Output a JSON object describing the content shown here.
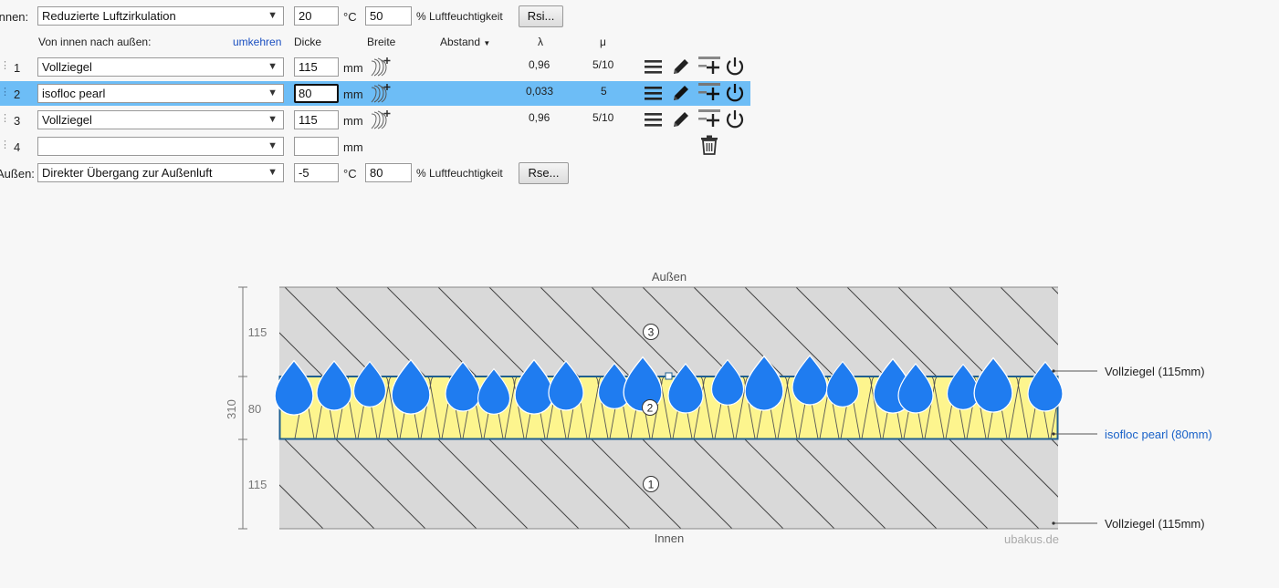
{
  "inside": {
    "label": "Innen:",
    "select_value": "Reduzierte Luftzirkulation",
    "temp": "20",
    "temp_unit": "°C",
    "humidity": "50",
    "humidity_label": "% Luftfeuchtigkeit",
    "button": "Rsi..."
  },
  "outside": {
    "label": "Außen:",
    "select_value": "Direkter Übergang zur Außenluft",
    "temp": "-5",
    "temp_unit": "°C",
    "humidity": "80",
    "humidity_label": "% Luftfeuchtigkeit",
    "button": "Rse..."
  },
  "headers": {
    "direction": "Von innen nach außen:",
    "reverse": "umkehren",
    "thickness": "Dicke",
    "width": "Breite",
    "spacing": "Abstand",
    "lambda": "λ",
    "mu": "μ"
  },
  "layers": [
    {
      "num": "1",
      "material": "Vollziegel",
      "thickness": "115",
      "unit": "mm",
      "lambda": "0,96",
      "mu": "5/10"
    },
    {
      "num": "2",
      "material": "isofloc pearl",
      "thickness": "80",
      "unit": "mm",
      "lambda": "0,033",
      "mu": "5",
      "selected": true
    },
    {
      "num": "3",
      "material": "Vollziegel",
      "thickness": "115",
      "unit": "mm",
      "lambda": "0,96",
      "mu": "5/10"
    },
    {
      "num": "4",
      "material": "",
      "thickness": "",
      "unit": "mm"
    }
  ],
  "icons": [
    "hatch-icon",
    "menu-icon",
    "pencil-icon",
    "insert-layer-icon",
    "power-icon",
    "trash-icon"
  ],
  "diagram": {
    "top_label": "Außen",
    "bottom_label": "Innen",
    "watermark": "ubakus.de",
    "total": "310",
    "dims": [
      "115",
      "80",
      "115"
    ],
    "layer_markers": [
      "3",
      "2",
      "1"
    ],
    "callouts": [
      "Vollziegel (115mm)",
      "isofloc pearl (80mm)",
      "Vollziegel (115mm)"
    ],
    "colors": {
      "brick": "#d9d9d9",
      "insulation": "#fdf58e",
      "highlight_border": "#1f5f8f",
      "drop": "#1f7cf0",
      "link": "#1a62c8"
    }
  }
}
